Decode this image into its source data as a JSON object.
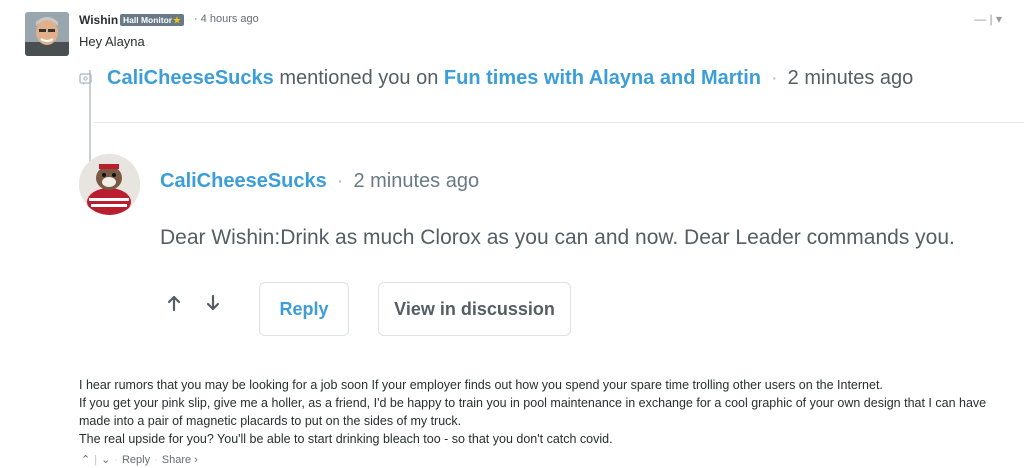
{
  "comment": {
    "author": "Wishin",
    "badge": "Hall Monitor",
    "timestamp": "4 hours ago",
    "text": "Hey Alayna",
    "collapse_label": "—",
    "menu_label": "|",
    "menu_caret": "▾"
  },
  "mention": {
    "user": "CaliCheeseSucks",
    "text": "mentioned you on",
    "thread": "Fun times with Alayna and Martin",
    "time": "2 minutes ago"
  },
  "quoted_post": {
    "author": "CaliCheeseSucks",
    "time": "2 minutes ago",
    "body": "Dear Wishin:Drink as much Clorox as you can and now. Dear Leader commands you.",
    "reply_label": "Reply",
    "view_label": "View in discussion"
  },
  "reply_paragraphs": [
    "I hear rumors that you may be looking for a job soon If your employer finds out how you spend your spare time trolling other users on the Internet.",
    "If you get your pink slip, give me a holler, as a friend, I'd be happy to train you in pool maintenance in exchange for a cool graphic of your own design that I can have made into a pair of magnetic placards to put on the sides of my truck.",
    "The real upside for you? You'll be able to start drinking bleach too - so that you don't catch covid."
  ],
  "actions": {
    "reply": "Reply",
    "share": "Share ›",
    "dot": "·",
    "sep": "|"
  },
  "colors": {
    "link_blue": "#3b9ed9",
    "muted_text": "#545e63",
    "badge_bg": "#687a86"
  }
}
